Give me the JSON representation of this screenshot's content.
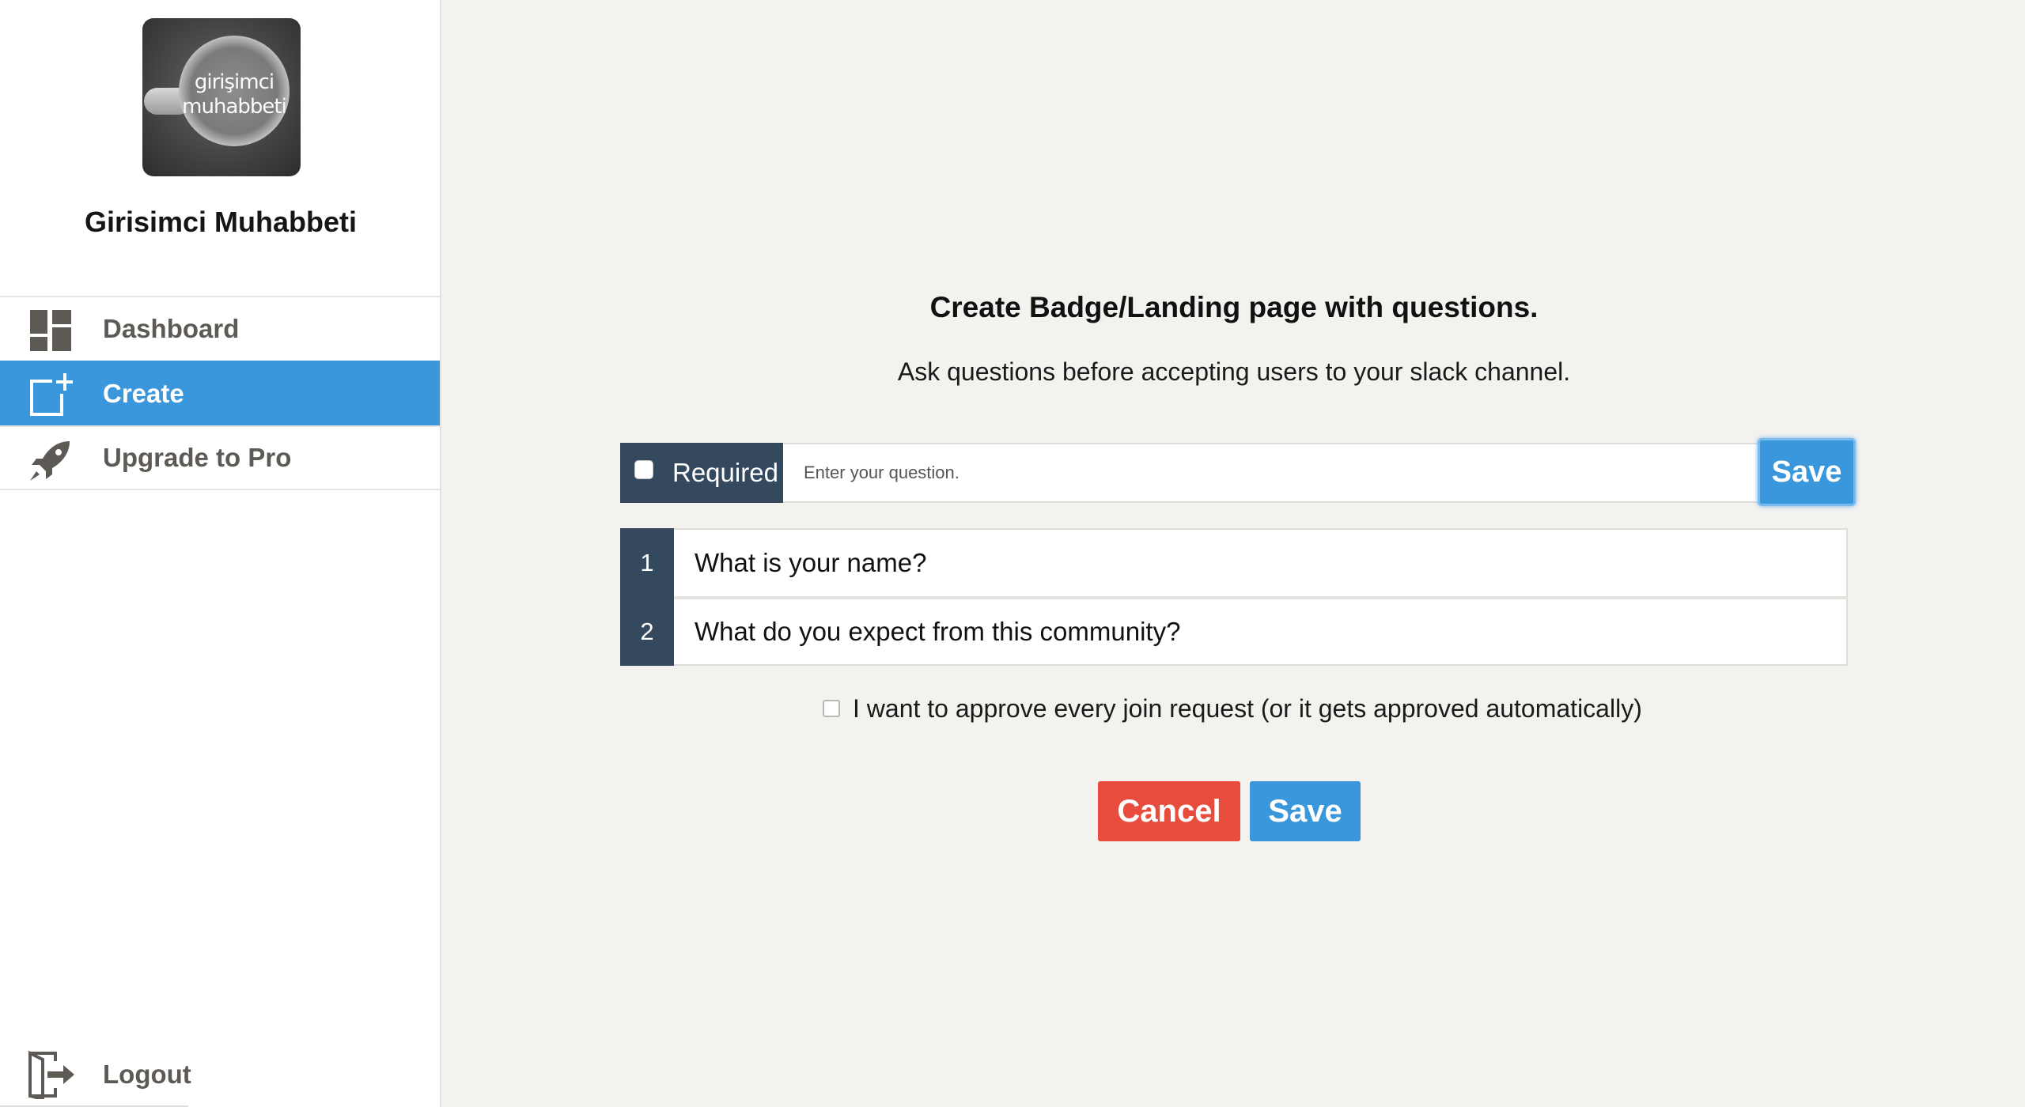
{
  "team": {
    "logo_text_line1": "girişimci",
    "logo_text_line2": "muhabbeti",
    "name": "Girisimci Muhabbeti"
  },
  "sidebar": {
    "items": [
      {
        "label": "Dashboard",
        "icon": "dashboard-icon",
        "active": false
      },
      {
        "label": "Create",
        "icon": "create-icon",
        "active": true
      },
      {
        "label": "Upgrade to Pro",
        "icon": "rocket-icon",
        "active": false
      }
    ],
    "logout_label": "Logout",
    "active_color": "#3a97dc"
  },
  "main": {
    "title": "Create Badge/Landing page with questions.",
    "subtitle": "Ask questions before accepting users to your slack channel.",
    "question_bar": {
      "required_label": "Required",
      "required_checked": false,
      "input_value": "",
      "input_placeholder": "Enter your question.",
      "save_label": "Save"
    },
    "questions": [
      {
        "number": "1",
        "text": "What is your name?"
      },
      {
        "number": "2",
        "text": "What do you expect from this community?"
      }
    ],
    "approve_label": "I want to approve every join request (or it gets approved automatically)",
    "approve_checked": false,
    "cancel_label": "Cancel",
    "save_label": "Save"
  },
  "colors": {
    "primary": "#3a97dc",
    "danger": "#e74c3c",
    "dark_label": "#34485e"
  }
}
